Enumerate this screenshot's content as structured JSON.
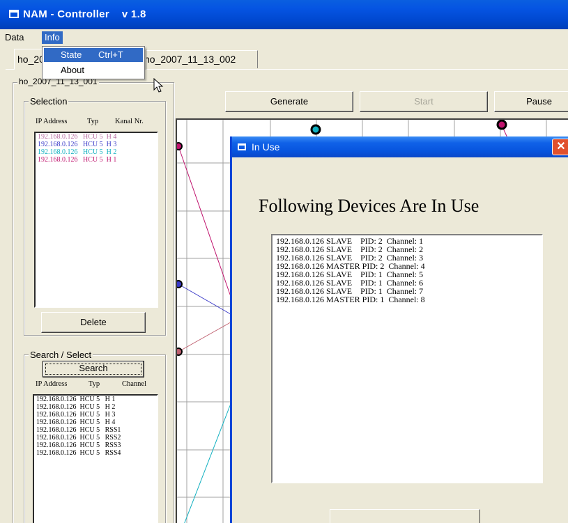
{
  "window": {
    "title": "NAM - Controller    v 1.8"
  },
  "menubar": {
    "data_label": "Data",
    "info_label": "Info"
  },
  "info_menu": {
    "items": [
      {
        "label": "State",
        "shortcut": "Ctrl+T"
      },
      {
        "label": "About",
        "shortcut": ""
      }
    ]
  },
  "tabs": [
    {
      "label": "ho_2007_11_13_001"
    },
    {
      "label": "ho_2007_11_13_002"
    }
  ],
  "outer_group": {
    "label": "ho_2007_11_13_001"
  },
  "selection": {
    "label": "Selection",
    "col_ip": "IP Address",
    "col_typ": "Typ",
    "col_kanal": "Kanal Nr.",
    "rows": [
      {
        "text": "192.168.0.126   HCU 5  H 4",
        "color": "#b56aa0"
      },
      {
        "text": "192.168.0.126   HCU 5  H 3",
        "color": "#3a3ac8"
      },
      {
        "text": "192.168.0.126   HCU 5  H 2",
        "color": "#10b0c0"
      },
      {
        "text": "192.168.0.126   HCU 5  H 1",
        "color": "#c0146e"
      }
    ],
    "delete_label": "Delete"
  },
  "search": {
    "label": "Search / Select",
    "button_label": "Search",
    "col_ip": "IP Address",
    "col_typ": "Typ",
    "col_channel": "Channel",
    "rows": [
      "192.168.0.126  HCU 5   H 1",
      "192.168.0.126  HCU 5   H 2",
      "192.168.0.126  HCU 5   H 3",
      "192.168.0.126  HCU 5   H 4",
      "192.168.0.126  HCU 5   RSS1",
      "192.168.0.126  HCU 5   RSS2",
      "192.168.0.126  HCU 5   RSS3",
      "192.168.0.126  HCU 5   RSS4"
    ]
  },
  "toolbar": {
    "generate_label": "Generate",
    "start_label": "Start",
    "pause_label": "Pause"
  },
  "dialog": {
    "title": "In Use",
    "close_glyph": "✕",
    "heading": "Following Devices Are In Use",
    "rows": [
      "192.168.0.126 SLAVE    PID: 2  Channel: 1",
      "192.168.0.126 SLAVE    PID: 2  Channel: 2",
      "192.168.0.126 SLAVE    PID: 2  Channel: 3",
      "192.168.0.126 MASTER PID: 2  Channel: 4",
      "192.168.0.126 SLAVE    PID: 1  Channel: 5",
      "192.168.0.126 SLAVE    PID: 1  Channel: 6",
      "192.168.0.126 SLAVE    PID: 1  Channel: 7",
      "192.168.0.126 MASTER PID: 1  Channel: 8"
    ]
  }
}
